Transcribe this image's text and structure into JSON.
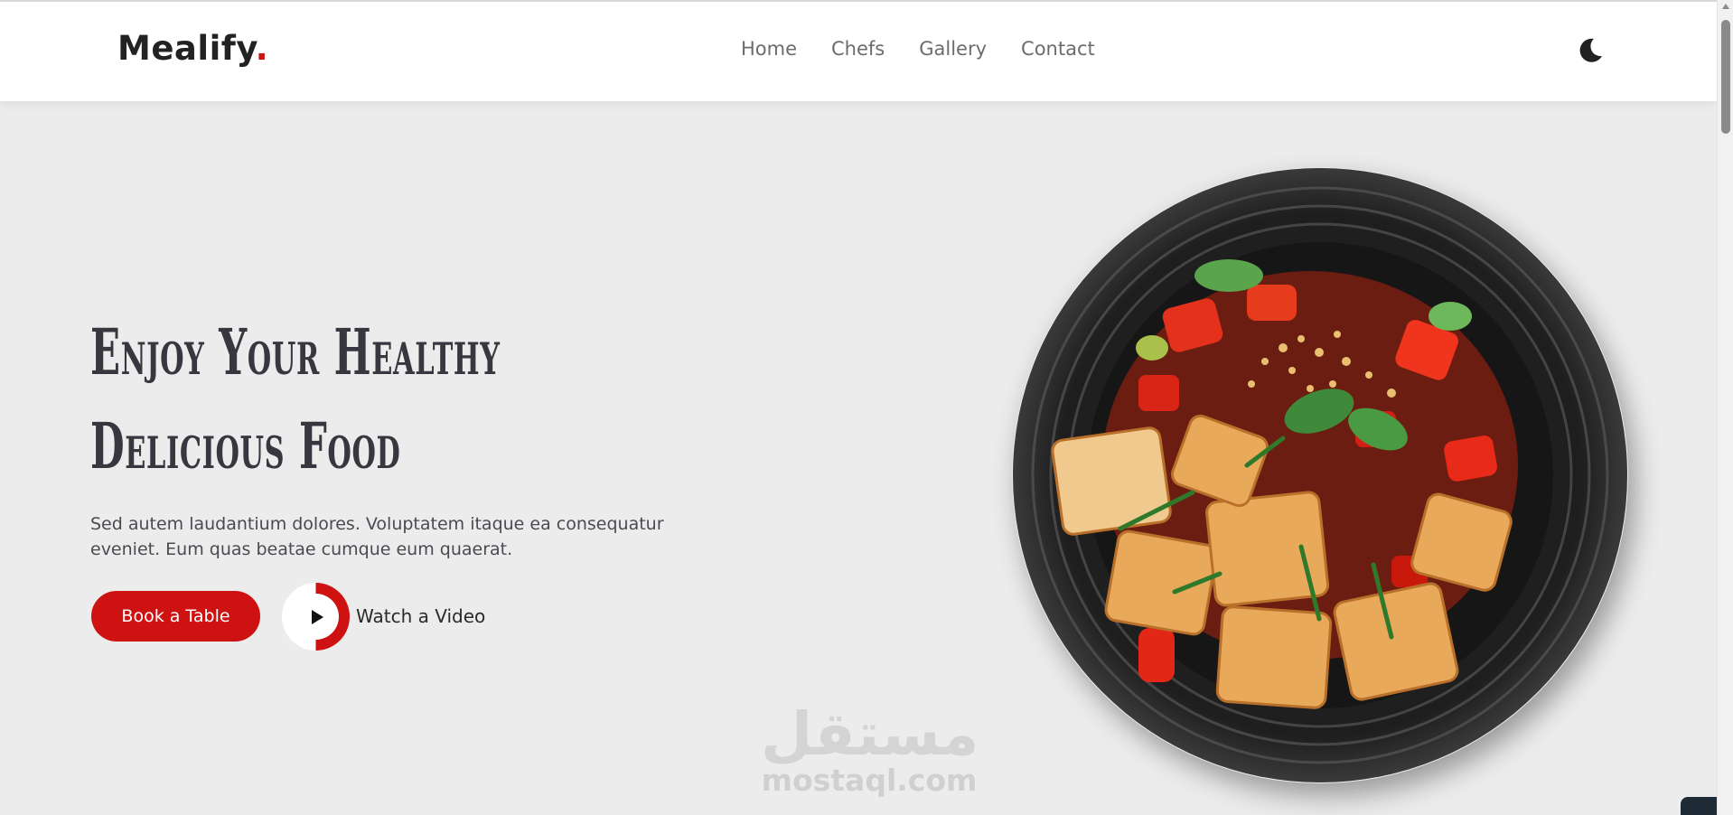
{
  "brand": {
    "name": "Mealify",
    "dot": ".",
    "accent_color": "#ce1212"
  },
  "nav": {
    "items": [
      {
        "label": "Home"
      },
      {
        "label": "Chefs"
      },
      {
        "label": "Gallery"
      },
      {
        "label": "Contact"
      }
    ]
  },
  "theme_toggle": {
    "icon": "moon-icon"
  },
  "hero": {
    "title_line1": "Enjoy Your Healthy",
    "title_line2": "Delicious Food",
    "description": "Sed autem laudantium dolores. Voluptatem itaque ea consequatur eveniet. Eum quas beatae cumque eum quaerat.",
    "book_button": "Book a Table",
    "video_label": "Watch a Video",
    "image": "dish-plate-image"
  },
  "watermark": {
    "arabic": "مستقل",
    "latin": "mostaql.com"
  },
  "colors": {
    "background": "#ececec",
    "header": "#ffffff",
    "text_dark": "#37373f",
    "accent": "#ce1212"
  }
}
